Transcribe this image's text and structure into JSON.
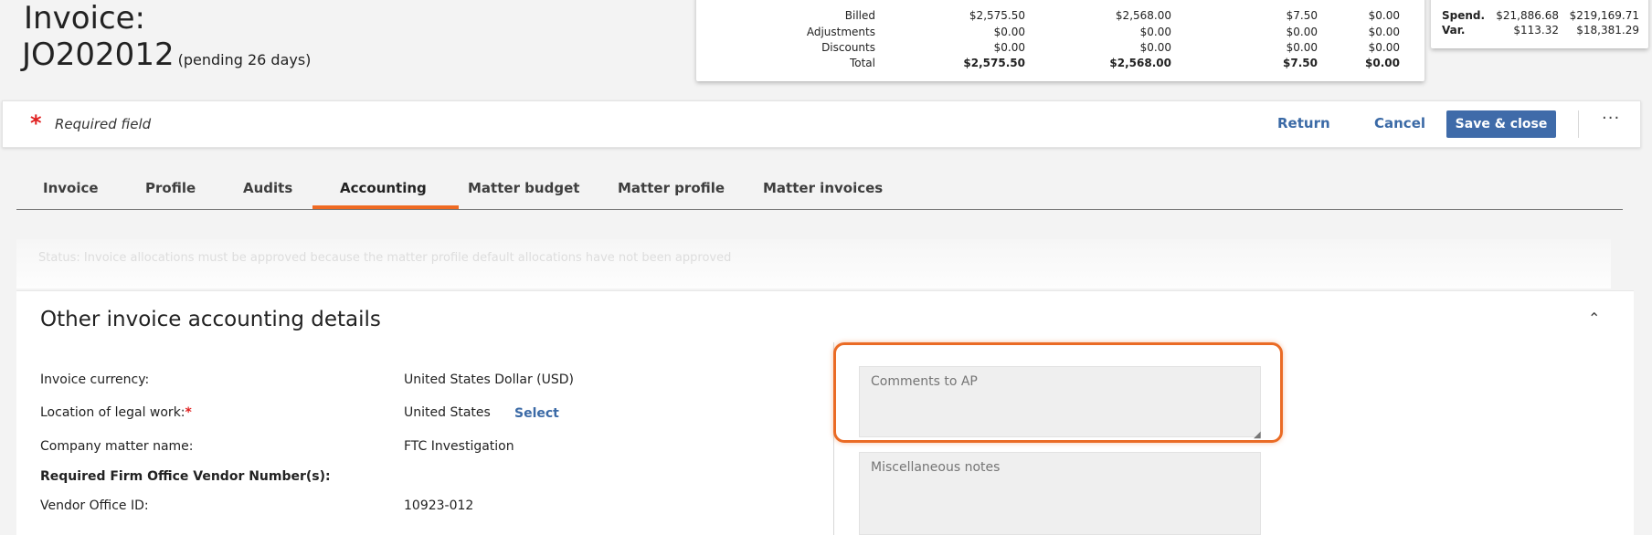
{
  "header": {
    "title_prefix": "Invoice:",
    "invoice_number": "JO202012",
    "pending": "(pending 26 days)"
  },
  "totals": {
    "rows": [
      {
        "label": "Billed",
        "total": "$2,575.50",
        "fees": "$2,568.00",
        "expenses": "$7.50",
        "tax": "$0.00"
      },
      {
        "label": "Adjustments",
        "total": "$0.00",
        "fees": "$0.00",
        "expenses": "$0.00",
        "tax": "$0.00"
      },
      {
        "label": "Discounts",
        "total": "$0.00",
        "fees": "$0.00",
        "expenses": "$0.00",
        "tax": "$0.00"
      },
      {
        "label": "Total",
        "total": "$2,575.50",
        "fees": "$2,568.00",
        "expenses": "$7.50",
        "tax": "$0.00"
      }
    ]
  },
  "budget": {
    "rows": [
      {
        "label": "Spend.",
        "v1": "$21,886.68",
        "v2": "$219,169.71"
      },
      {
        "label": "Var.",
        "v1": "$113.32",
        "v2": "$18,381.29"
      }
    ]
  },
  "actionbar": {
    "required_star": "*",
    "required_text": "Required field",
    "return_label": "Return",
    "cancel_label": "Cancel",
    "save_label": "Save & close",
    "more_label": "···"
  },
  "tabs": [
    {
      "label": "Invoice"
    },
    {
      "label": "Profile"
    },
    {
      "label": "Audits"
    },
    {
      "label": "Accounting"
    },
    {
      "label": "Matter budget"
    },
    {
      "label": "Matter profile"
    },
    {
      "label": "Matter invoices"
    }
  ],
  "status": {
    "text": "Status: Invoice allocations must be approved because the matter profile default allocations have not been approved"
  },
  "section": {
    "title": "Other invoice accounting details",
    "collapse_icon": "chevron-up-icon",
    "fields": {
      "currency_label": "Invoice currency:",
      "currency_value": "United States Dollar (USD)",
      "location_label": "Location of legal work:",
      "location_star": "*",
      "location_value": "United States",
      "select_label": "Select",
      "matter_label": "Company matter name:",
      "matter_value": "FTC Investigation",
      "vendor_heading": "Required Firm Office Vendor Number(s):",
      "vendor_label": "Vendor Office ID:",
      "vendor_value": "10923-012"
    },
    "comments_placeholder": "Comments to AP",
    "notes_placeholder": "Miscellaneous notes"
  },
  "colors": {
    "accent": "#ef6a22",
    "primary": "#3f6ba9",
    "link": "#3b6aa6",
    "required": "#e02020"
  }
}
